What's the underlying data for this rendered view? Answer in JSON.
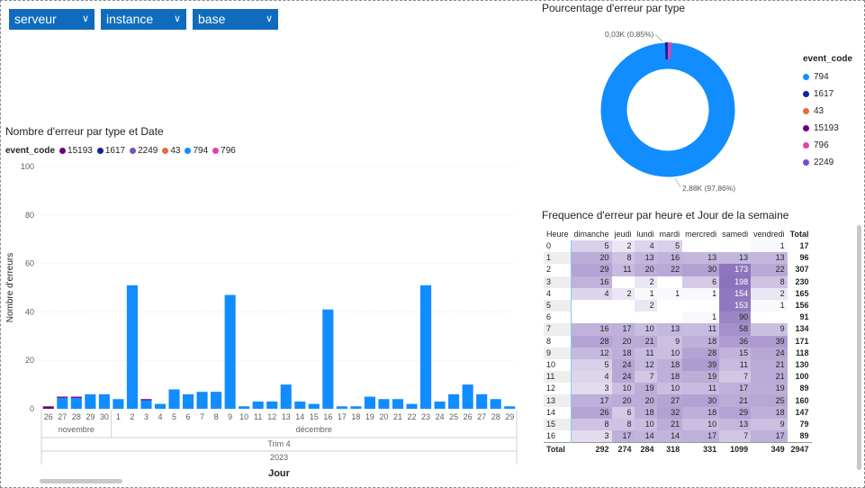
{
  "slicers": [
    {
      "label": "serveur"
    },
    {
      "label": "instance"
    },
    {
      "label": "base"
    }
  ],
  "donut": {
    "title": "Pourcentage d'erreur par type",
    "legend_title": "event_code",
    "legend": [
      {
        "label": "794",
        "color": "#118dff"
      },
      {
        "label": "1617",
        "color": "#12239e"
      },
      {
        "label": "43",
        "color": "#e66c37"
      },
      {
        "label": "15193",
        "color": "#6b007b"
      },
      {
        "label": "796",
        "color": "#e044a7"
      },
      {
        "label": "2249",
        "color": "#744ec2"
      }
    ],
    "label_small": "0,03K (0,85%)",
    "label_big": "2,88K (97,86%)"
  },
  "bar": {
    "title": "Nombre d'erreur par type et Date",
    "legend_title": "event_code",
    "legend": [
      {
        "label": "15193",
        "color": "#6b007b"
      },
      {
        "label": "1617",
        "color": "#12239e"
      },
      {
        "label": "2249",
        "color": "#744ec2"
      },
      {
        "label": "43",
        "color": "#e66c37"
      },
      {
        "label": "794",
        "color": "#118dff"
      },
      {
        "label": "796",
        "color": "#e044a7"
      }
    ],
    "month_nov": "novembre",
    "month_dec": "décembre",
    "quarter": "Trim 4",
    "year": "2023"
  },
  "chart_data": {
    "type": "bar",
    "stacked": true,
    "title": "Nombre d'erreur par type et Date",
    "xlabel": "Jour",
    "ylabel": "Nombre d'erreurs",
    "ylim": [
      0,
      100
    ],
    "yticks": [
      "0",
      "20",
      "40",
      "60",
      "80",
      "100"
    ],
    "categories": [
      "26",
      "27",
      "28",
      "29",
      "30",
      "1",
      "2",
      "3",
      "4",
      "5",
      "6",
      "7",
      "8",
      "9",
      "10",
      "11",
      "12",
      "13",
      "14",
      "15",
      "16",
      "17",
      "18",
      "19",
      "20",
      "21",
      "22",
      "23",
      "24",
      "25",
      "26",
      "27",
      "28",
      "29"
    ],
    "series": [
      {
        "name": "15193",
        "values": [
          1,
          0.5,
          0.5,
          0,
          0,
          0,
          0,
          0.5,
          0,
          0,
          0,
          0,
          0,
          0,
          0,
          0,
          0,
          0,
          0,
          0,
          0,
          0,
          0,
          0,
          0,
          0,
          0,
          0,
          0,
          0,
          0,
          0,
          0,
          0
        ]
      },
      {
        "name": "794",
        "values": [
          0,
          4.5,
          4.5,
          6,
          6,
          4,
          51,
          3.5,
          2,
          8,
          6,
          7,
          7,
          47,
          1,
          3,
          3,
          10,
          3,
          2,
          41,
          1,
          1,
          5,
          4,
          4,
          2,
          51,
          3,
          6,
          10,
          6,
          4,
          1
        ]
      }
    ]
  },
  "matrix": {
    "title": "Frequence d'erreur par heure et Jour de la semaine",
    "columns": [
      "Heure",
      "dimanche",
      "jeudi",
      "lundi",
      "mardi",
      "mercredi",
      "samedi",
      "vendredi",
      "Total"
    ],
    "rows": [
      [
        "0",
        "5",
        "2",
        "4",
        "5",
        "",
        "",
        "1",
        "17"
      ],
      [
        "1",
        "20",
        "8",
        "13",
        "16",
        "13",
        "13",
        "13",
        "96"
      ],
      [
        "2",
        "29",
        "11",
        "20",
        "22",
        "30",
        "173",
        "22",
        "307"
      ],
      [
        "3",
        "16",
        "",
        "2",
        "",
        "6",
        "198",
        "8",
        "230"
      ],
      [
        "4",
        "4",
        "2",
        "1",
        "1",
        "1",
        "154",
        "2",
        "165"
      ],
      [
        "5",
        "",
        "",
        "2",
        "",
        "",
        "153",
        "1",
        "156"
      ],
      [
        "6",
        "",
        "",
        "",
        "",
        "1",
        "90",
        "",
        "91"
      ],
      [
        "7",
        "16",
        "17",
        "10",
        "13",
        "11",
        "58",
        "9",
        "134"
      ],
      [
        "8",
        "28",
        "20",
        "21",
        "9",
        "18",
        "36",
        "39",
        "171"
      ],
      [
        "9",
        "12",
        "18",
        "11",
        "10",
        "28",
        "15",
        "24",
        "118"
      ],
      [
        "10",
        "5",
        "24",
        "12",
        "18",
        "39",
        "11",
        "21",
        "130"
      ],
      [
        "11",
        "4",
        "24",
        "7",
        "18",
        "19",
        "7",
        "21",
        "100"
      ],
      [
        "12",
        "3",
        "10",
        "19",
        "10",
        "11",
        "17",
        "19",
        "89"
      ],
      [
        "13",
        "17",
        "20",
        "20",
        "27",
        "30",
        "21",
        "25",
        "160"
      ],
      [
        "14",
        "26",
        "6",
        "18",
        "32",
        "18",
        "29",
        "18",
        "147"
      ],
      [
        "15",
        "8",
        "8",
        "10",
        "21",
        "10",
        "13",
        "9",
        "79"
      ],
      [
        "16",
        "3",
        "17",
        "14",
        "14",
        "17",
        "7",
        "17",
        "89"
      ]
    ],
    "totals": [
      "Total",
      "292",
      "274",
      "284",
      "318",
      "331",
      "1099",
      "349",
      "2947"
    ]
  }
}
